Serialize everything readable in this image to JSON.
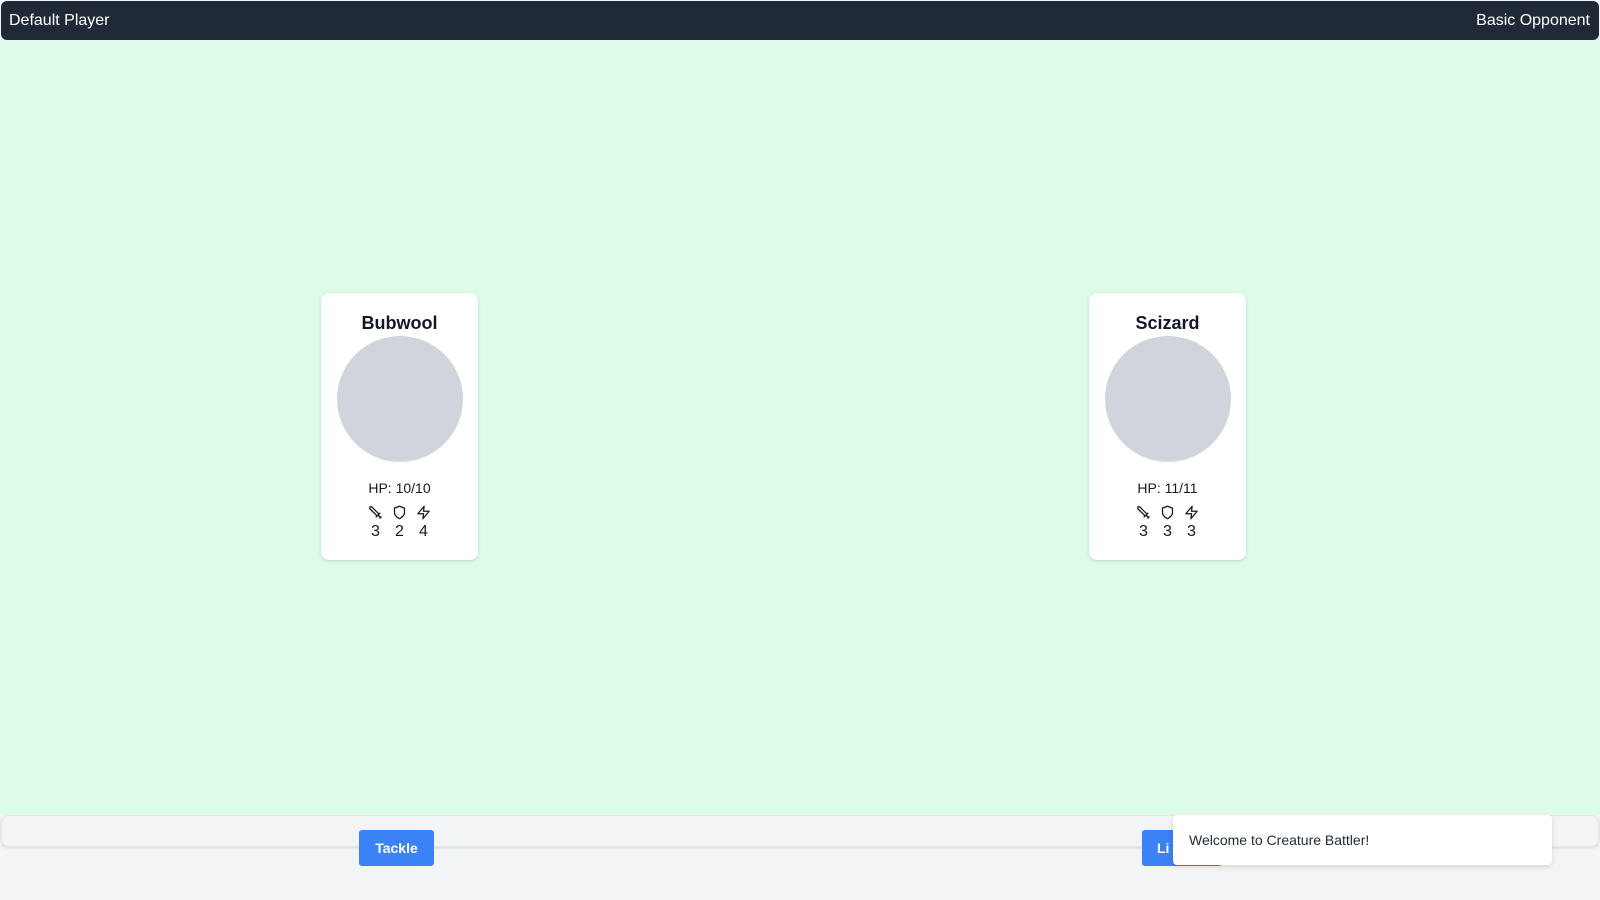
{
  "header": {
    "player_name": "Default Player",
    "opponent_name": "Basic Opponent"
  },
  "player_creature": {
    "name": "Bubwool",
    "hp_text": "HP: 10/10",
    "stats": [
      {
        "icon": "sword-icon",
        "value": "3"
      },
      {
        "icon": "shield-icon",
        "value": "2"
      },
      {
        "icon": "lightning-icon",
        "value": "4"
      }
    ]
  },
  "opponent_creature": {
    "name": "Scizard",
    "hp_text": "HP: 11/11",
    "stats": [
      {
        "icon": "sword-icon",
        "value": "3"
      },
      {
        "icon": "shield-icon",
        "value": "3"
      },
      {
        "icon": "lightning-icon",
        "value": "3"
      }
    ]
  },
  "actions": {
    "player_move": "Tackle",
    "opponent_move_visible": "Li"
  },
  "toast": {
    "message": "Welcome to Creature Battler!"
  },
  "colors": {
    "header_bg": "#1f2937",
    "arena_bg": "#dcfce7",
    "button_bg": "#3b82f6",
    "avatar_placeholder": "#d1d5db"
  }
}
